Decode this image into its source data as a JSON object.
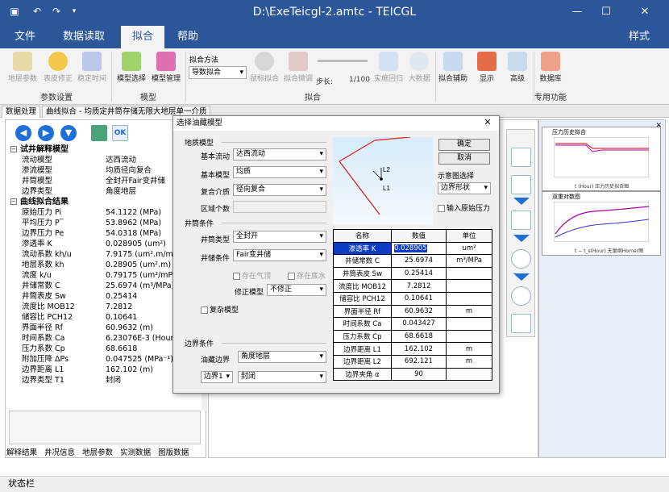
{
  "window": {
    "title": "D:\\ExeTeicgl-2.amtc - TEICGL"
  },
  "menu": {
    "items": [
      "文件",
      "数据读取",
      "拟合",
      "帮助"
    ],
    "right": "样式"
  },
  "ribbon": {
    "buttons": [
      {
        "label": "地层参数",
        "enabled": false
      },
      {
        "label": "表皮修正",
        "enabled": false
      },
      {
        "label": "稳定时间",
        "enabled": false
      },
      {
        "label": "模型选择",
        "enabled": true
      },
      {
        "label": "模型管理",
        "enabled": true
      }
    ],
    "fit_method_label": "拟合方法",
    "fit_method_value": "导数拟合",
    "tools": [
      "鼠标拟合",
      "拟合微调",
      "步长:",
      "1/100",
      "实施回归",
      "大数据"
    ],
    "right_buttons": [
      "拟合辅助",
      "显示",
      "高级",
      "数据库"
    ],
    "groups": [
      "参数设置",
      "模型",
      "拟合",
      "专用功能"
    ]
  },
  "doc_tabs": [
    "数据处理",
    "曲线拟合 - 均质定井筒存储无限大地层单一介质"
  ],
  "left_panel": {
    "nav_icons": [
      "back-icon",
      "forward-icon",
      "down-icon",
      "export-icon",
      "ok-icon"
    ],
    "sections": [
      {
        "title": "试井解释模型",
        "rows": [
          [
            "流动模型",
            "达西流动"
          ],
          [
            "渗流模型",
            "均质径向复合"
          ],
          [
            "井筒模型",
            "全封开Fair变井储"
          ],
          [
            "边界类型",
            "角度地层"
          ]
        ]
      },
      {
        "title": "曲线拟合结果",
        "rows": [
          [
            "原始压力 Pi",
            "54.1122  (MPa)"
          ],
          [
            "平均压力 P‾",
            "53.8962  (MPa)"
          ],
          [
            "边界压力 Pe",
            "54.0318  (MPa)"
          ],
          [
            "渗透率 K",
            "0.028905  (um²)"
          ],
          [
            "流动系数 kh/u",
            "7.9175  (um².m/mP"
          ],
          [
            "地层系数 kh",
            "0.28905  (um².m)"
          ],
          [
            "流度 k/u",
            "0.79175  (um²/mPa"
          ],
          [
            "井储常数 C",
            "25.6974  (m³/MPa)"
          ],
          [
            "井筒表皮 Sw",
            "0.25414"
          ],
          [
            "流度比 MOB12",
            "7.2812"
          ],
          [
            "储容比 PCH12",
            "0.10641"
          ],
          [
            "界面半径 Rf",
            "60.9632  (m)"
          ],
          [
            "时间系数 Ca",
            "6.23076E-3  (Hour"
          ],
          [
            "压力系数 Cp",
            "68.6618"
          ],
          [
            "附加压降 ΔPs",
            "0.047525  (MPa⁻¹)"
          ],
          [
            "边界距离 L1",
            "162.102  (m)"
          ],
          [
            "边界类型 T1",
            "封闭"
          ]
        ]
      }
    ],
    "bottom_tabs": [
      "解释结果",
      "井况信息",
      "地层参数",
      "实测数据",
      "图版数据"
    ]
  },
  "dialog": {
    "title": "选择油藏模型",
    "geology_label": "地质模型",
    "basic_flow_label": "基本流动",
    "basic_flow_value": "达西流动",
    "basic_model_label": "基本模型",
    "basic_model_value": "均质",
    "composite_label": "复合介质",
    "composite_value": "径向复合",
    "zone_count_label": "区域个数",
    "wellbore_label": "井筒条件",
    "wellbore_type_label": "井筒类型",
    "wellbore_type_value": "全封开",
    "storage_label": "井储条件",
    "storage_value": "Fair变井储",
    "gas_label": "存在气顶",
    "water_label": "存在底水",
    "correction_label": "修正模型",
    "correction_value": "不修正",
    "complex_label": "复杂模型",
    "boundary_label": "边界条件",
    "reservoir_boundary_label": "油藏边界",
    "reservoir_boundary_value": "角度地层",
    "boundary1_value": "边界1",
    "boundary1_type": "封闭",
    "ok": "确定",
    "cancel": "取消",
    "diagram_label": "示意图选择",
    "diagram_value": "边界形状",
    "input_pressure": "输入原始压力",
    "diagram_labels": [
      "L2",
      "L1"
    ],
    "table_headers": [
      "名称",
      "数值",
      "单位"
    ],
    "table_rows": [
      [
        "渗透率 K",
        "0.028905",
        "um²"
      ],
      [
        "井储常数 C",
        "25.6974",
        "m³/MPa"
      ],
      [
        "井筒表皮 Sw",
        "0.25414",
        ""
      ],
      [
        "流度比 MOB12",
        "7.2812",
        ""
      ],
      [
        "储容比 PCH12",
        "0.10641",
        ""
      ],
      [
        "界面半径 Rf",
        "60.9632",
        "m"
      ],
      [
        "时间系数 Ca",
        "0.043427",
        ""
      ],
      [
        "压力系数 Cp",
        "68.6618",
        ""
      ],
      [
        "边界距离 L1",
        "162.102",
        "m"
      ],
      [
        "边界距离 L2",
        "692.121",
        "m"
      ],
      [
        "边界夹角 α",
        "90",
        ""
      ]
    ]
  },
  "thumbnails": [
    {
      "title": "压力历史拟合",
      "xlabel": "t (Hour)\n压力历史拟合图"
    },
    {
      "title": "双重对数图",
      "xlabel": "t − t_s(Hour)\n无量纲Horner图"
    }
  ],
  "status": "状态栏",
  "colors": {
    "brand": "#2b579a",
    "accent": "#1e6fd9",
    "selected": "#0a3cc8"
  }
}
